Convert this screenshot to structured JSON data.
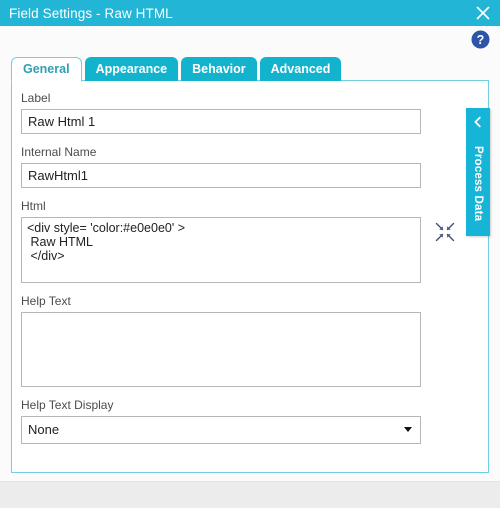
{
  "window": {
    "title": "Field Settings - Raw HTML",
    "close_icon": "close-icon",
    "help_icon": "help-icon"
  },
  "tabs": [
    {
      "label": "General",
      "active": true
    },
    {
      "label": "Appearance",
      "active": false
    },
    {
      "label": "Behavior",
      "active": false
    },
    {
      "label": "Advanced",
      "active": false
    }
  ],
  "form": {
    "label_field": {
      "label": "Label",
      "value": "Raw Html 1",
      "placeholder": ""
    },
    "internal_name_field": {
      "label": "Internal Name",
      "value": "RawHtml1",
      "placeholder": ""
    },
    "html_field": {
      "label": "Html",
      "value": "<div style= 'color:#e0e0e0' >\n Raw HTML\n </div>",
      "placeholder": "",
      "expand_icon": "collapse-arrows-icon"
    },
    "help_text_field": {
      "label": "Help Text",
      "value": "",
      "placeholder": ""
    },
    "help_text_display_field": {
      "label": "Help Text Display",
      "value": "None",
      "options": [
        "None"
      ]
    }
  },
  "side_panel": {
    "label": "Process Data",
    "chevron_icon": "chevron-left-icon"
  },
  "colors": {
    "title_bar": "#22b5d6",
    "tab_active_text": "#2f9fb5",
    "tab_inactive_bg": "#13b3ce",
    "panel_border": "#72cfe0",
    "side_tab_bg": "#16b5d8",
    "help_icon_blue": "#2c54a8"
  }
}
